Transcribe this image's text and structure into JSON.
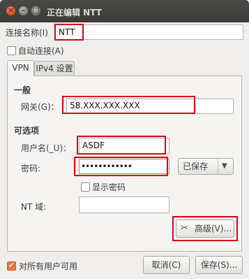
{
  "window": {
    "title": "正在编辑 NTT"
  },
  "connection": {
    "name_label": "连接名称(I)",
    "name_value": "NTT",
    "auto_connect_label": "自动连接(A)"
  },
  "tabs": [
    {
      "label": "VPN"
    },
    {
      "label": "IPv4 设置"
    }
  ],
  "general": {
    "heading": "一般",
    "gateway_label": "网关(G)：",
    "gateway_value": "58.XXX.XXX.XXX"
  },
  "optional": {
    "heading": "可选项",
    "username_label": "用户名(_U)：",
    "username_value": "ASDF",
    "password_label": "密码:",
    "password_value": "••••••••••••",
    "password_store": "已保存",
    "show_password_label": "显示密码",
    "nt_domain_label": "NT 域:",
    "nt_domain_value": ""
  },
  "advanced_button": "高级(V)...",
  "footer": {
    "all_users_label": "对所有用户可用",
    "cancel_label": "取消(C)",
    "save_label": "保存(S)..."
  }
}
